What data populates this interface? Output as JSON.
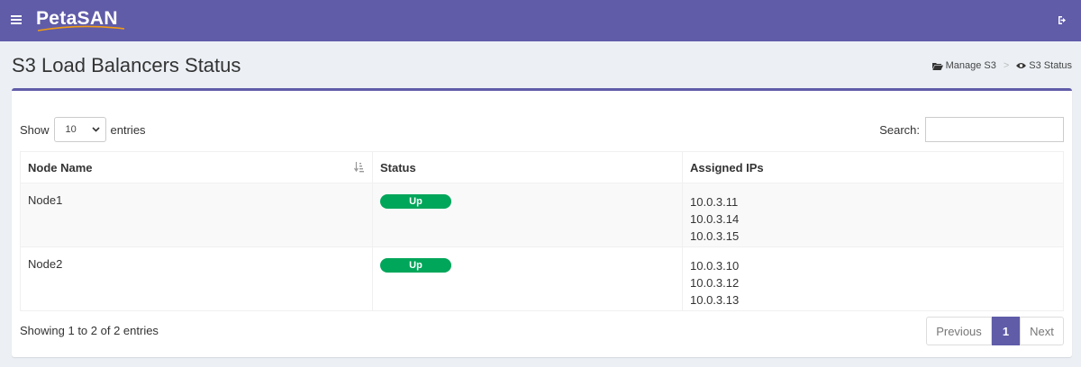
{
  "header": {
    "logo": "PetaSAN",
    "menu_icon": "hamburger-icon",
    "logout_icon": "sign-out-icon",
    "color": "#605ca8"
  },
  "page": {
    "title": "S3 Load Balancers Status"
  },
  "breadcrumb": [
    {
      "label": "Manage S3",
      "icon": "folder-open-icon"
    },
    {
      "label": "S3 Status",
      "icon": "eye-icon"
    }
  ],
  "controls": {
    "show_label": "Show",
    "page_size": "10",
    "entries_label": "entries",
    "search_label": "Search:",
    "search_value": ""
  },
  "table": {
    "columns": [
      "Node Name",
      "Status",
      "Assigned IPs"
    ],
    "rows": [
      {
        "node": "Node1",
        "status": "Up",
        "ips": [
          "10.0.3.11",
          "10.0.3.14",
          "10.0.3.15"
        ]
      },
      {
        "node": "Node2",
        "status": "Up",
        "ips": [
          "10.0.3.10",
          "10.0.3.12",
          "10.0.3.13"
        ]
      }
    ],
    "status_color": "#00a65a"
  },
  "footer": {
    "info": "Showing 1 to 2 of 2 entries",
    "prev": "Previous",
    "current_page": "1",
    "next": "Next"
  }
}
